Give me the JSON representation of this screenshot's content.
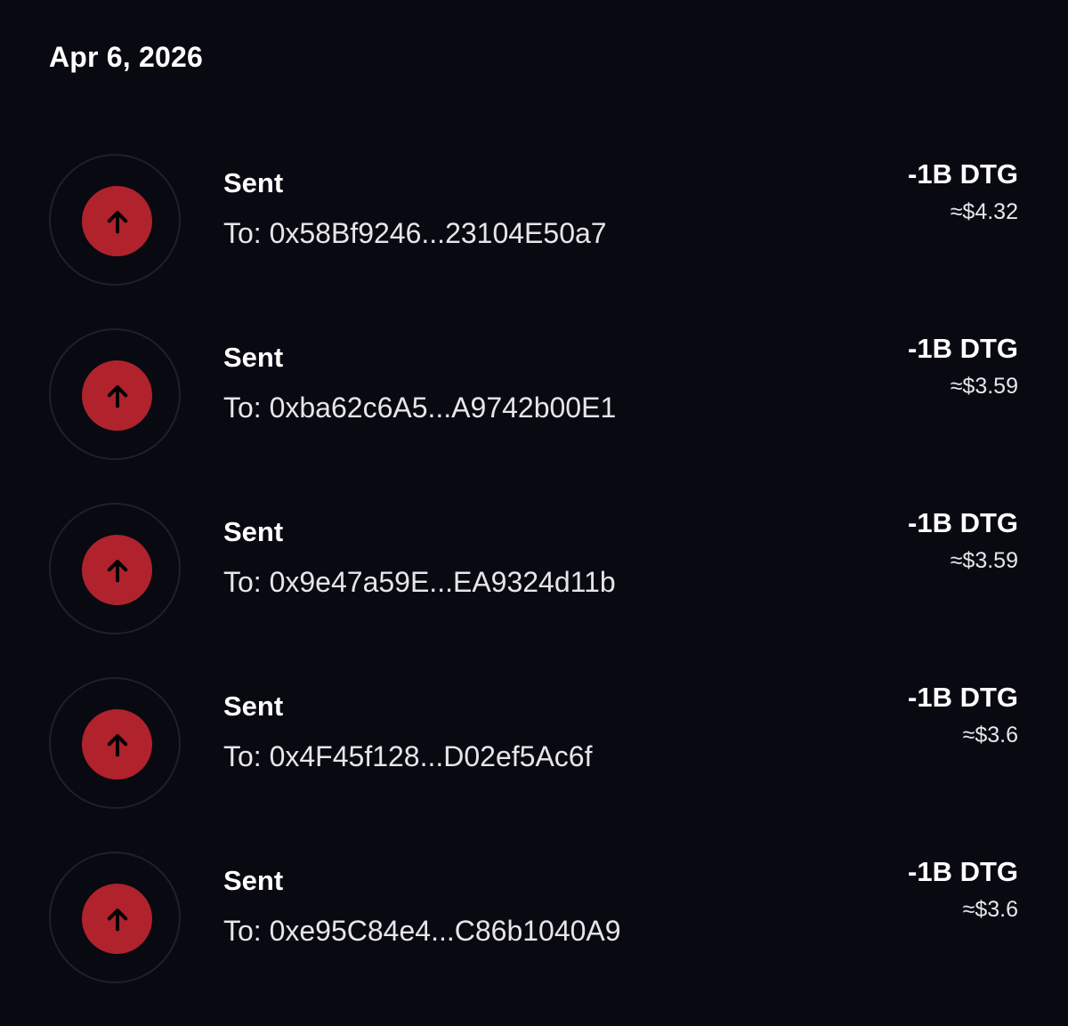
{
  "header": {
    "date": "Apr 6, 2026"
  },
  "transactions": [
    {
      "type": "Sent",
      "to": "To: 0x58Bf9246...23104E50a7",
      "amount": "-1B DTG",
      "fiat": "≈$4.32",
      "icon": "arrow-up-icon"
    },
    {
      "type": "Sent",
      "to": "To: 0xba62c6A5...A9742b00E1",
      "amount": "-1B DTG",
      "fiat": "≈$3.59",
      "icon": "arrow-up-icon"
    },
    {
      "type": "Sent",
      "to": "To: 0x9e47a59E...EA9324d11b",
      "amount": "-1B DTG",
      "fiat": "≈$3.59",
      "icon": "arrow-up-icon"
    },
    {
      "type": "Sent",
      "to": "To: 0x4F45f128...D02ef5Ac6f",
      "amount": "-1B DTG",
      "fiat": "≈$3.6",
      "icon": "arrow-up-icon"
    },
    {
      "type": "Sent",
      "to": "To: 0xe95C84e4...C86b1040A9",
      "amount": "-1B DTG",
      "fiat": "≈$3.6",
      "icon": "arrow-up-icon"
    }
  ],
  "colors": {
    "background": "#080911",
    "sent_icon": "#b0222c",
    "icon_ring": "#1f202a",
    "text_primary": "#ffffff",
    "text_secondary": "#e6e6ea"
  }
}
